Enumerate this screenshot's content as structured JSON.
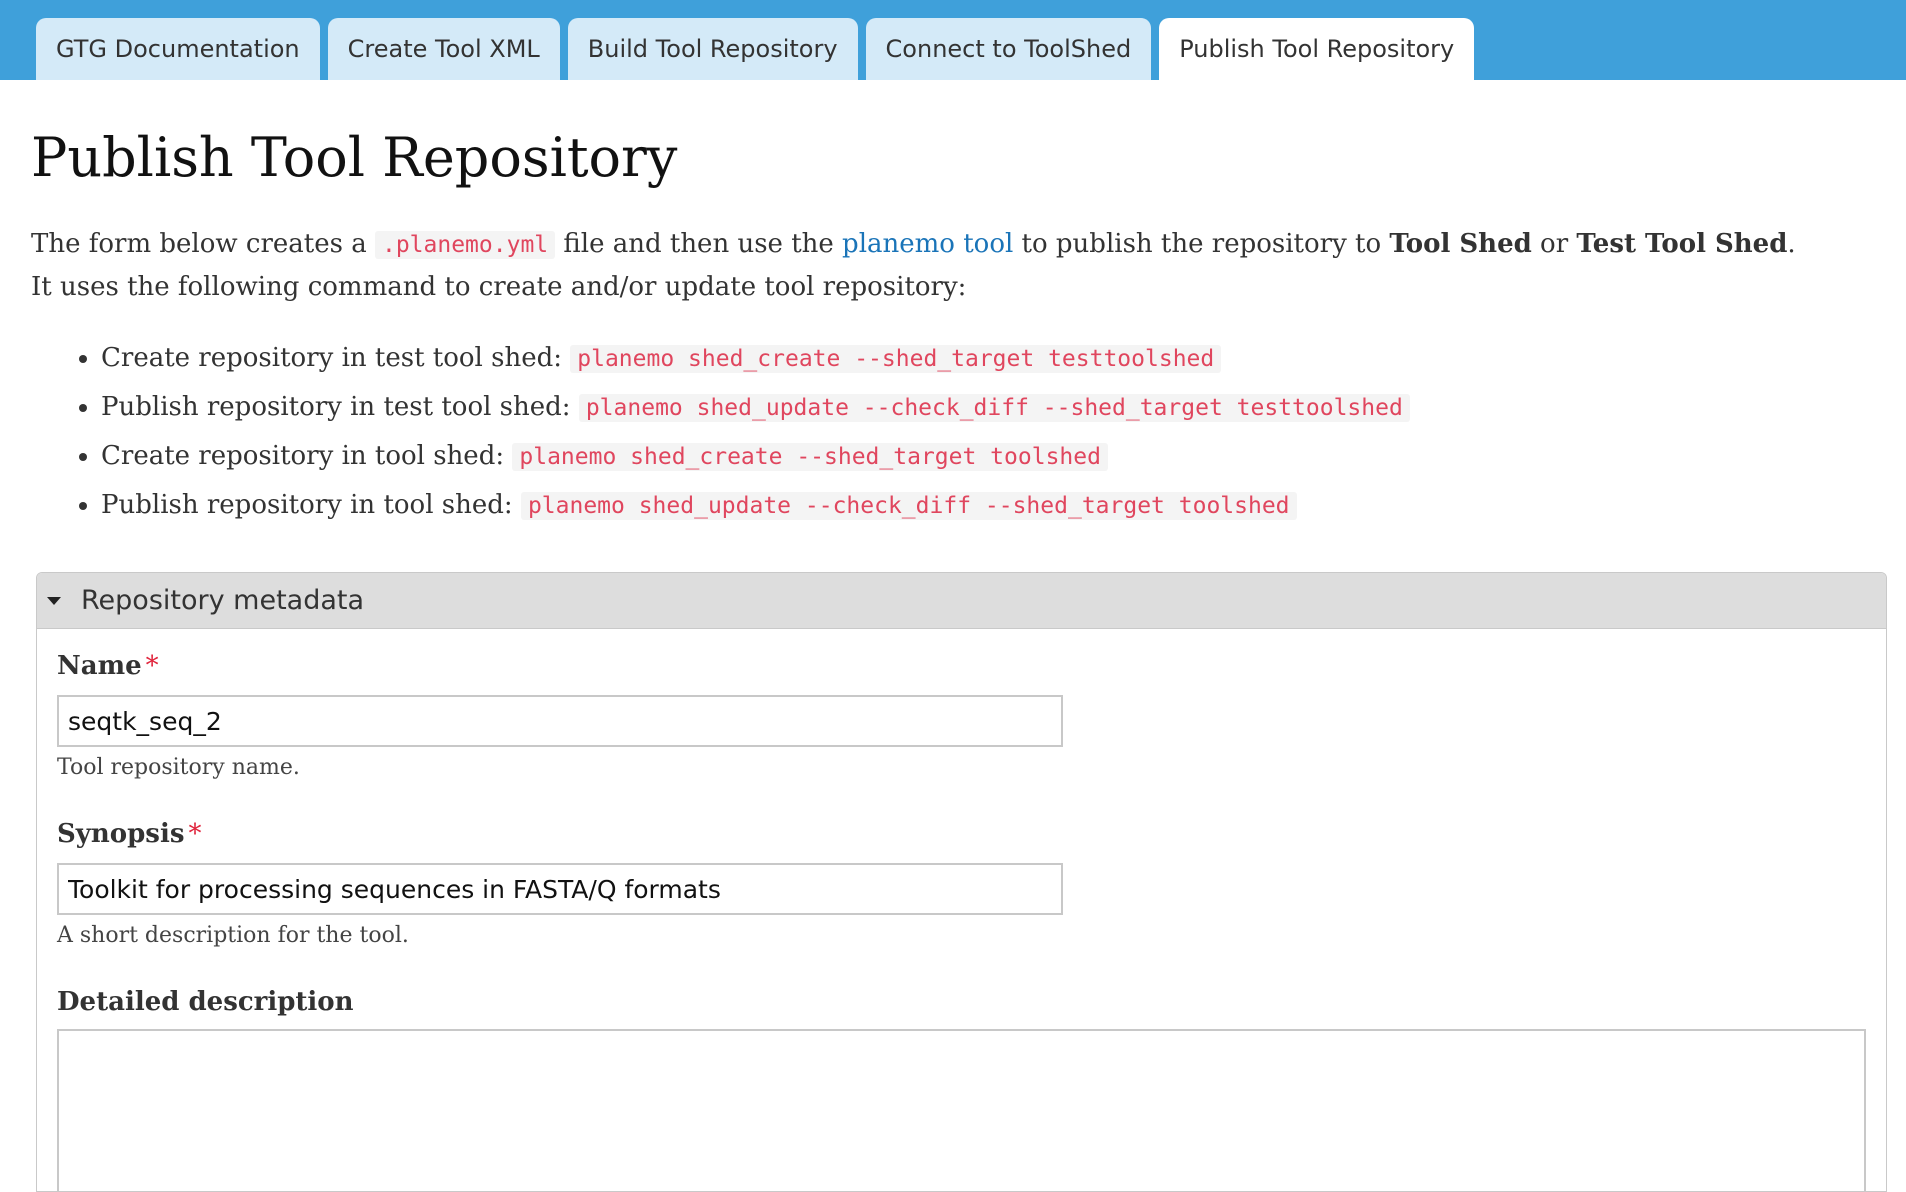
{
  "tabs": [
    {
      "label": "GTG Documentation",
      "active": false
    },
    {
      "label": "Create Tool XML",
      "active": false
    },
    {
      "label": "Build Tool Repository",
      "active": false
    },
    {
      "label": "Connect to ToolShed",
      "active": false
    },
    {
      "label": "Publish Tool Repository",
      "active": true
    }
  ],
  "page": {
    "title": "Publish Tool Repository",
    "intro": {
      "part1": "The form below creates a ",
      "file_code": ".planemo.yml",
      "part2": " file and then use the ",
      "link": "planemo tool",
      "part3": " to publish the repository to ",
      "bold1": "Tool Shed",
      "part4": " or ",
      "bold2": "Test Tool Shed",
      "part5": ".",
      "line2": "It uses the following command to create and/or update tool repository:"
    },
    "commands": [
      {
        "label": "Create repository in test tool shed:",
        "code": "planemo shed_create --shed_target testtoolshed"
      },
      {
        "label": "Publish repository in test tool shed:",
        "code": "planemo shed_update --check_diff --shed_target testtoolshed"
      },
      {
        "label": "Create repository in tool shed:",
        "code": "planemo shed_create --shed_target toolshed"
      },
      {
        "label": "Publish repository in tool shed:",
        "code": "planemo shed_update --check_diff --shed_target toolshed"
      }
    ]
  },
  "panel": {
    "title": "Repository metadata",
    "fields": {
      "name": {
        "label": "Name",
        "required": "*",
        "value": "seqtk_seq_2",
        "help": "Tool repository name."
      },
      "synopsis": {
        "label": "Synopsis",
        "required": "*",
        "value": "Toolkit for processing sequences in FASTA/Q formats",
        "help": "A short description for the tool."
      },
      "description": {
        "label": "Detailed description",
        "value": ""
      }
    }
  },
  "colors": {
    "topbar": "#3fa0da",
    "tab_inactive": "#d4eaf8",
    "code_text": "#e0465e",
    "link": "#1a74b8",
    "required": "#e0233b"
  }
}
